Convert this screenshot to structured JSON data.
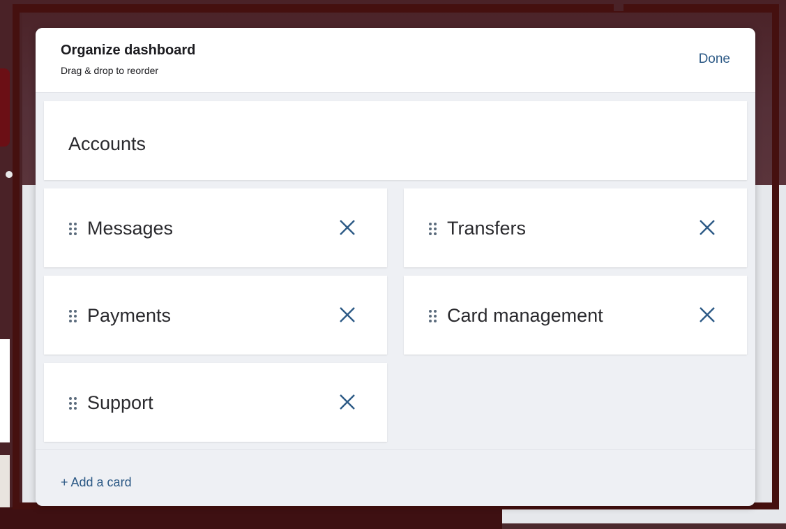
{
  "modal": {
    "title": "Organize dashboard",
    "subtitle": "Drag & drop to reorder",
    "done_label": "Done"
  },
  "cards": {
    "pinned": {
      "label": "Accounts"
    },
    "items": [
      {
        "label": "Messages"
      },
      {
        "label": "Transfers"
      },
      {
        "label": "Payments"
      },
      {
        "label": "Card management"
      },
      {
        "label": "Support"
      }
    ]
  },
  "footer": {
    "add_card_label": "+ Add a card"
  },
  "icons": {
    "drag": "drag-handle-icon",
    "remove": "close-icon"
  },
  "colors": {
    "accent": "#2d5a86",
    "backdrop": "#45100f",
    "modal_bg": "#eef0f4",
    "card_bg": "#ffffff"
  }
}
